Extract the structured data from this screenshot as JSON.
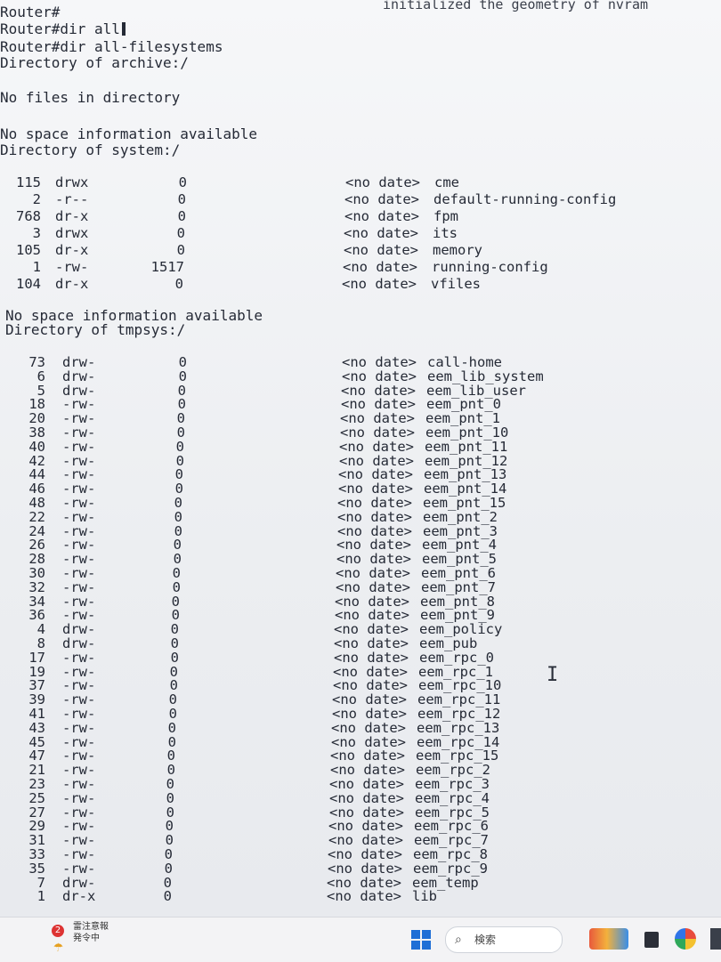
{
  "console": {
    "top_msg": "initialized the geometry of nvram",
    "lines": [
      "Router#",
      "Router#dir all",
      "Router#dir all-filesystems"
    ],
    "archive_header": "Directory of archive:/",
    "archive_empty": "No files in directory",
    "archive_nospace": "No space information available",
    "system_header": "Directory of system:/",
    "system_entries": [
      {
        "idx": "115",
        "perm": "drwx",
        "size": "0",
        "date": "<no date>",
        "name": "cme"
      },
      {
        "idx": "2",
        "perm": "-r--",
        "size": "0",
        "date": "<no date>",
        "name": "default-running-config"
      },
      {
        "idx": "768",
        "perm": "dr-x",
        "size": "0",
        "date": "<no date>",
        "name": "fpm"
      },
      {
        "idx": "3",
        "perm": "drwx",
        "size": "0",
        "date": "<no date>",
        "name": "its"
      },
      {
        "idx": "105",
        "perm": "dr-x",
        "size": "0",
        "date": "<no date>",
        "name": "memory"
      },
      {
        "idx": "1",
        "perm": "-rw-",
        "size": "1517",
        "date": "<no date>",
        "name": "running-config"
      },
      {
        "idx": "104",
        "perm": "dr-x",
        "size": "0",
        "date": "<no date>",
        "name": "vfiles"
      }
    ],
    "system_nospace": "No space information available",
    "tmpsys_header": "Directory of tmpsys:/",
    "tmpsys_entries": [
      {
        "idx": "73",
        "perm": "drw-",
        "size": "0",
        "date": "<no date>",
        "name": "call-home"
      },
      {
        "idx": "6",
        "perm": "drw-",
        "size": "0",
        "date": "<no date>",
        "name": "eem_lib_system"
      },
      {
        "idx": "5",
        "perm": "drw-",
        "size": "0",
        "date": "<no date>",
        "name": "eem_lib_user"
      },
      {
        "idx": "18",
        "perm": "-rw-",
        "size": "0",
        "date": "<no date>",
        "name": "eem_pnt_0"
      },
      {
        "idx": "20",
        "perm": "-rw-",
        "size": "0",
        "date": "<no date>",
        "name": "eem_pnt_1"
      },
      {
        "idx": "38",
        "perm": "-rw-",
        "size": "0",
        "date": "<no date>",
        "name": "eem_pnt_10"
      },
      {
        "idx": "40",
        "perm": "-rw-",
        "size": "0",
        "date": "<no date>",
        "name": "eem_pnt_11"
      },
      {
        "idx": "42",
        "perm": "-rw-",
        "size": "0",
        "date": "<no date>",
        "name": "eem_pnt_12"
      },
      {
        "idx": "44",
        "perm": "-rw-",
        "size": "0",
        "date": "<no date>",
        "name": "eem_pnt_13"
      },
      {
        "idx": "46",
        "perm": "-rw-",
        "size": "0",
        "date": "<no date>",
        "name": "eem_pnt_14"
      },
      {
        "idx": "48",
        "perm": "-rw-",
        "size": "0",
        "date": "<no date>",
        "name": "eem_pnt_15"
      },
      {
        "idx": "22",
        "perm": "-rw-",
        "size": "0",
        "date": "<no date>",
        "name": "eem_pnt_2"
      },
      {
        "idx": "24",
        "perm": "-rw-",
        "size": "0",
        "date": "<no date>",
        "name": "eem_pnt_3"
      },
      {
        "idx": "26",
        "perm": "-rw-",
        "size": "0",
        "date": "<no date>",
        "name": "eem_pnt_4"
      },
      {
        "idx": "28",
        "perm": "-rw-",
        "size": "0",
        "date": "<no date>",
        "name": "eem_pnt_5"
      },
      {
        "idx": "30",
        "perm": "-rw-",
        "size": "0",
        "date": "<no date>",
        "name": "eem_pnt_6"
      },
      {
        "idx": "32",
        "perm": "-rw-",
        "size": "0",
        "date": "<no date>",
        "name": "eem_pnt_7"
      },
      {
        "idx": "34",
        "perm": "-rw-",
        "size": "0",
        "date": "<no date>",
        "name": "eem_pnt_8"
      },
      {
        "idx": "36",
        "perm": "-rw-",
        "size": "0",
        "date": "<no date>",
        "name": "eem_pnt_9"
      },
      {
        "idx": "4",
        "perm": "drw-",
        "size": "0",
        "date": "<no date>",
        "name": "eem_policy"
      },
      {
        "idx": "8",
        "perm": "drw-",
        "size": "0",
        "date": "<no date>",
        "name": "eem_pub"
      },
      {
        "idx": "17",
        "perm": "-rw-",
        "size": "0",
        "date": "<no date>",
        "name": "eem_rpc_0"
      },
      {
        "idx": "19",
        "perm": "-rw-",
        "size": "0",
        "date": "<no date>",
        "name": "eem_rpc_1"
      },
      {
        "idx": "37",
        "perm": "-rw-",
        "size": "0",
        "date": "<no date>",
        "name": "eem_rpc_10"
      },
      {
        "idx": "39",
        "perm": "-rw-",
        "size": "0",
        "date": "<no date>",
        "name": "eem_rpc_11"
      },
      {
        "idx": "41",
        "perm": "-rw-",
        "size": "0",
        "date": "<no date>",
        "name": "eem_rpc_12"
      },
      {
        "idx": "43",
        "perm": "-rw-",
        "size": "0",
        "date": "<no date>",
        "name": "eem_rpc_13"
      },
      {
        "idx": "45",
        "perm": "-rw-",
        "size": "0",
        "date": "<no date>",
        "name": "eem_rpc_14"
      },
      {
        "idx": "47",
        "perm": "-rw-",
        "size": "0",
        "date": "<no date>",
        "name": "eem_rpc_15"
      },
      {
        "idx": "21",
        "perm": "-rw-",
        "size": "0",
        "date": "<no date>",
        "name": "eem_rpc_2"
      },
      {
        "idx": "23",
        "perm": "-rw-",
        "size": "0",
        "date": "<no date>",
        "name": "eem_rpc_3"
      },
      {
        "idx": "25",
        "perm": "-rw-",
        "size": "0",
        "date": "<no date>",
        "name": "eem_rpc_4"
      },
      {
        "idx": "27",
        "perm": "-rw-",
        "size": "0",
        "date": "<no date>",
        "name": "eem_rpc_5"
      },
      {
        "idx": "29",
        "perm": "-rw-",
        "size": "0",
        "date": "<no date>",
        "name": "eem_rpc_6"
      },
      {
        "idx": "31",
        "perm": "-rw-",
        "size": "0",
        "date": "<no date>",
        "name": "eem_rpc_7"
      },
      {
        "idx": "33",
        "perm": "-rw-",
        "size": "0",
        "date": "<no date>",
        "name": "eem_rpc_8"
      },
      {
        "idx": "35",
        "perm": "-rw-",
        "size": "0",
        "date": "<no date>",
        "name": "eem_rpc_9"
      },
      {
        "idx": "7",
        "perm": "drw-",
        "size": "0",
        "date": "<no date>",
        "name": "eem_temp"
      },
      {
        "idx": "1",
        "perm": "dr-x",
        "size": "0",
        "date": "<no date>",
        "name": "lib"
      }
    ]
  },
  "taskbar": {
    "notification_badge": "2",
    "notification_line1": "雷注意報",
    "notification_line2": "発令中",
    "search_placeholder": "検索"
  },
  "colors": {
    "text": "#252a36",
    "windows_blue": "#1f6fd6",
    "badge_red": "#dd3333"
  }
}
